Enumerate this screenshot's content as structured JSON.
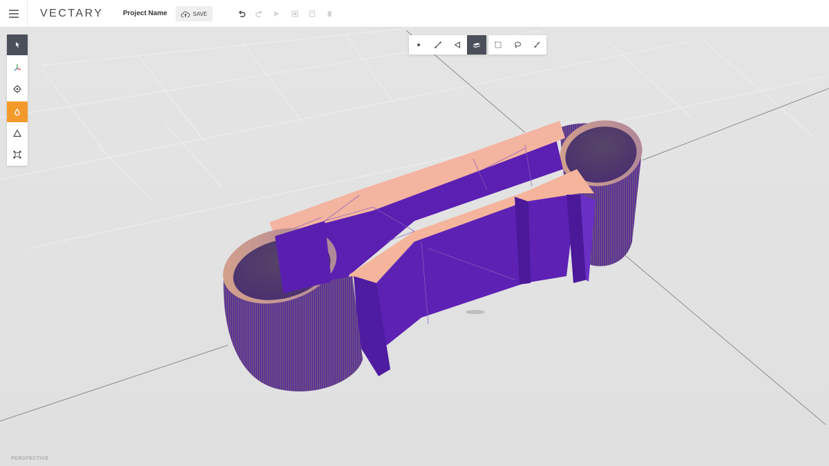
{
  "app": {
    "logo": "VECTARY",
    "project_name": "Project Name",
    "save_label": "SAVE"
  },
  "toolbar": {
    "history": [
      "undo-icon",
      "redo-icon",
      "play-icon",
      "export-icon",
      "copy-icon",
      "delete-icon"
    ]
  },
  "left_tools": [
    {
      "name": "select-tool",
      "icon": "cursor-arrow-icon",
      "state": "active"
    },
    {
      "name": "transform-tool",
      "icon": "axis-gizmo-icon",
      "state": "normal"
    },
    {
      "name": "pivot-tool",
      "icon": "target-icon",
      "state": "normal"
    },
    {
      "name": "material-tool",
      "icon": "drop-icon",
      "state": "active-orange"
    },
    {
      "name": "polygon-tool",
      "icon": "triangle-icon",
      "state": "normal"
    },
    {
      "name": "bounds-tool",
      "icon": "bounding-box-icon",
      "state": "normal"
    }
  ],
  "selection_modes": [
    {
      "name": "vertex-mode",
      "icon": "dot-icon"
    },
    {
      "name": "edge-mode",
      "icon": "edge-icon"
    },
    {
      "name": "face-mode",
      "icon": "triangle-outline-icon"
    },
    {
      "name": "object-mode",
      "icon": "layers-icon",
      "active": true
    }
  ],
  "selection_tools": [
    {
      "name": "box-select",
      "icon": "dashed-rect-icon"
    },
    {
      "name": "lasso-select",
      "icon": "lasso-icon"
    },
    {
      "name": "paint-select",
      "icon": "brush-icon"
    }
  ],
  "viewport": {
    "camera_label": "PERSPECTIVE"
  },
  "colors": {
    "accent_orange": "#f39a2b",
    "mesh_purple": "#5a1fb0",
    "mesh_top": "#f2b59a",
    "active_tool": "#4a4f5a"
  }
}
